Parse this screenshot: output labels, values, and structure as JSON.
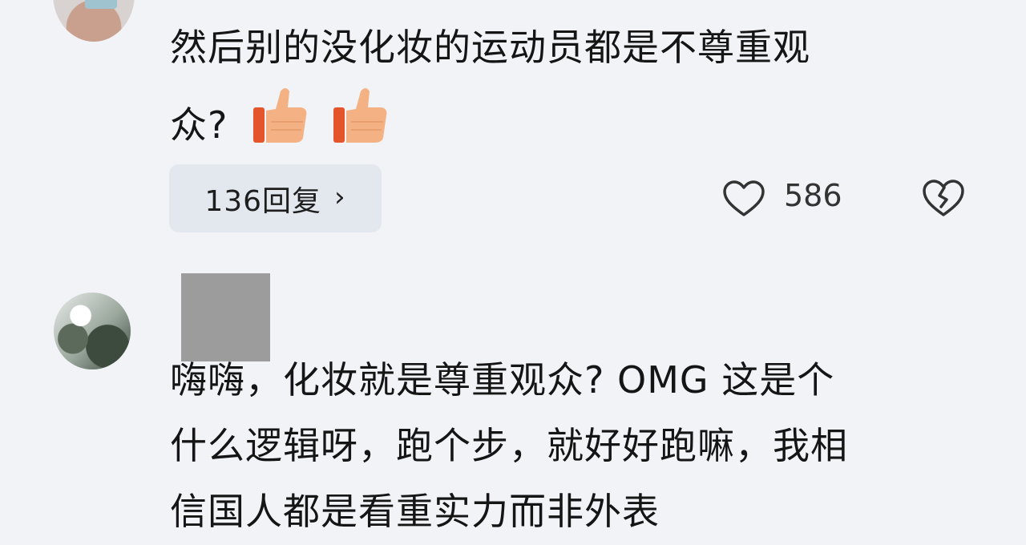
{
  "comment1": {
    "line1": "然后别的没化妆的运动员都是不尊重观",
    "line2": "众?",
    "emoji": "thumbs-up-icon",
    "reply_label": "136回复",
    "reply_chevron": "›",
    "like_count": "586",
    "colors": {
      "reply_bg": "#e3e8ef",
      "thumb": "#f4b183",
      "thumb_cuff": "#e5552b"
    }
  },
  "comment2": {
    "line1": "嗨嗨，化妆就是尊重观众? OMG 这是个",
    "line2": "什么逻辑呀，跑个步，就好好跑嘛，我相",
    "line3": "信国人都是看重实力而非外表"
  }
}
